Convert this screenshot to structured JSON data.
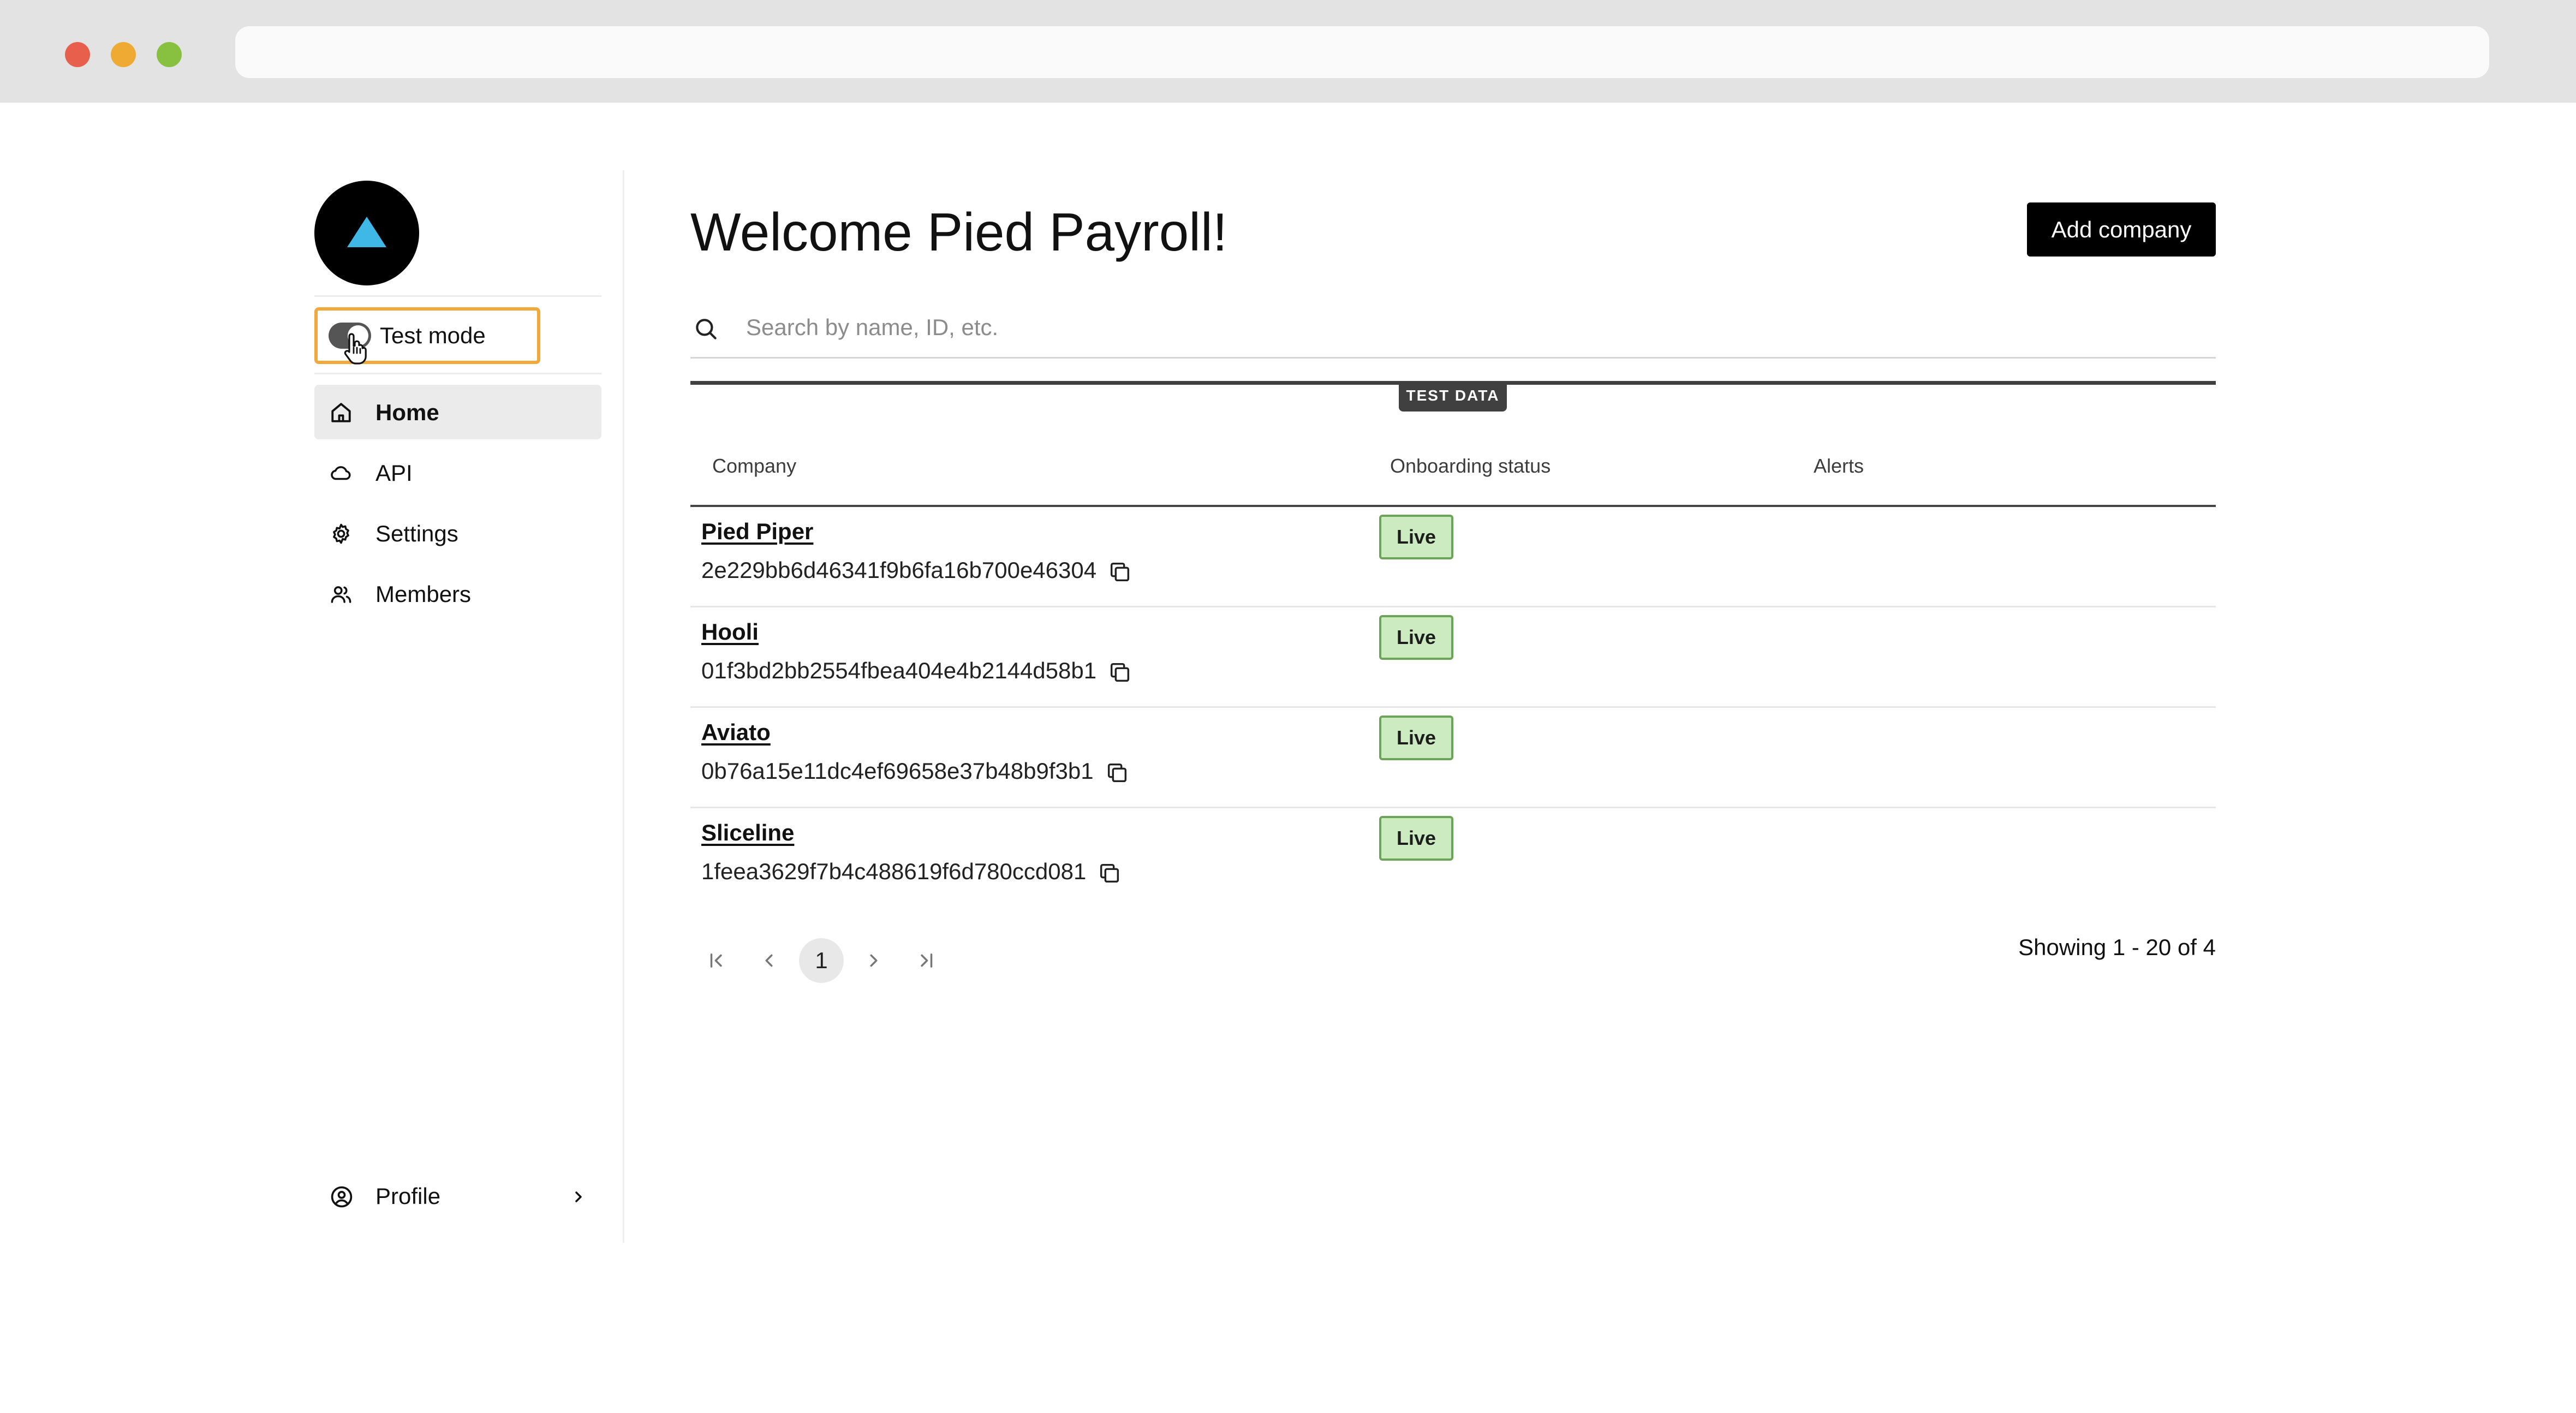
{
  "browser": {
    "address_value": ""
  },
  "sidebar": {
    "logo_icon": "triangle-logo",
    "test_mode": {
      "label": "Test mode",
      "enabled": true
    },
    "nav": [
      {
        "label": "Home",
        "icon": "home-icon",
        "active": true
      },
      {
        "label": "API",
        "icon": "cloud-icon",
        "active": false
      },
      {
        "label": "Settings",
        "icon": "gear-icon",
        "active": false
      },
      {
        "label": "Members",
        "icon": "users-icon",
        "active": false
      }
    ],
    "profile": {
      "label": "Profile",
      "icon": "user-circle-icon"
    }
  },
  "main": {
    "title": "Welcome Pied Payroll!",
    "add_company_label": "Add company",
    "search": {
      "placeholder": "Search by name, ID, etc.",
      "value": ""
    },
    "test_data_badge": "TEST DATA",
    "table": {
      "columns": [
        "Company",
        "Onboarding status",
        "Alerts"
      ],
      "rows": [
        {
          "name": "Pied Piper",
          "id": "2e229bb6d46341f9b6fa16b700e46304",
          "status": "Live",
          "alerts": ""
        },
        {
          "name": "Hooli",
          "id": "01f3bd2bb2554fbea404e4b2144d58b1",
          "status": "Live",
          "alerts": ""
        },
        {
          "name": "Aviato",
          "id": "0b76a15e11dc4ef69658e37b48b9f3b1",
          "status": "Live",
          "alerts": ""
        },
        {
          "name": "Sliceline",
          "id": "1feea3629f7b4c488619f6d780ccd081",
          "status": "Live",
          "alerts": ""
        }
      ]
    },
    "pagination": {
      "current_page": "1",
      "showing": "Showing 1 - 20 of 4"
    }
  },
  "colors": {
    "accent_highlight": "#f2a93b",
    "logo_triangle": "#3fb8e8",
    "live_bg": "#cdebc0",
    "live_border": "#6aa55a",
    "primary_button": "#000000"
  }
}
